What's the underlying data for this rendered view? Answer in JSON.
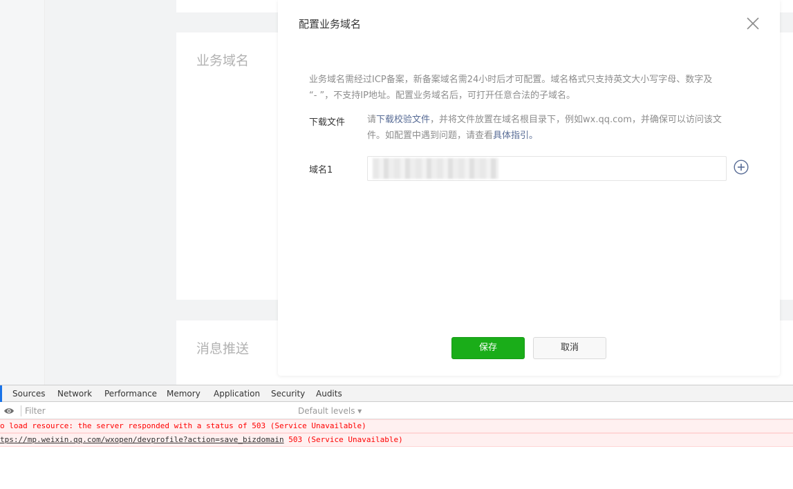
{
  "page": {
    "section_business_domain": "业务域名",
    "section_message_push": "消息推送"
  },
  "dialog": {
    "title": "配置业务域名",
    "close_icon": "close-icon",
    "description_line1": "业务域名需经过ICP备案，新备案域名需24小时后才可配置。域名格式只支持英文大小写字母、数字及",
    "description_line2": "“- ”，不支持IP地址。配置业务域名后，可打开任意合法的子域名。",
    "download_label": "下载文件",
    "download_text_prefix": "请",
    "download_link": "下载校验文件",
    "download_text_mid": "，并将文件放置在域名根目录下，例如wx.qq.com，并确保可以访问该文",
    "download_text_line2": "件。如配置中遇到问题，请查看",
    "guide_link": "具体指引。",
    "domain_label": "域名1",
    "domain_value": "",
    "add_icon": "plus-circle-icon",
    "save_label": "保存",
    "cancel_label": "取消",
    "colors": {
      "primary": "#1aad19",
      "link": "#576b95"
    }
  },
  "devtools": {
    "tabs": [
      "Sources",
      "Network",
      "Performance",
      "Memory",
      "Application",
      "Security",
      "Audits"
    ],
    "filter_placeholder": "Filter",
    "levels_label": "Default levels ▾",
    "errors": [
      {
        "text": "o load resource: the server responded with a status of 503 (Service Unavailable)"
      },
      {
        "url": "tps://mp.weixin.qq.com/wxopen/devprofile?action=save_bizdomain",
        "text": " 503 (Service Unavailable)"
      }
    ],
    "colors": {
      "error_text": "#ff0000",
      "error_bg": "#fff0f0"
    }
  }
}
